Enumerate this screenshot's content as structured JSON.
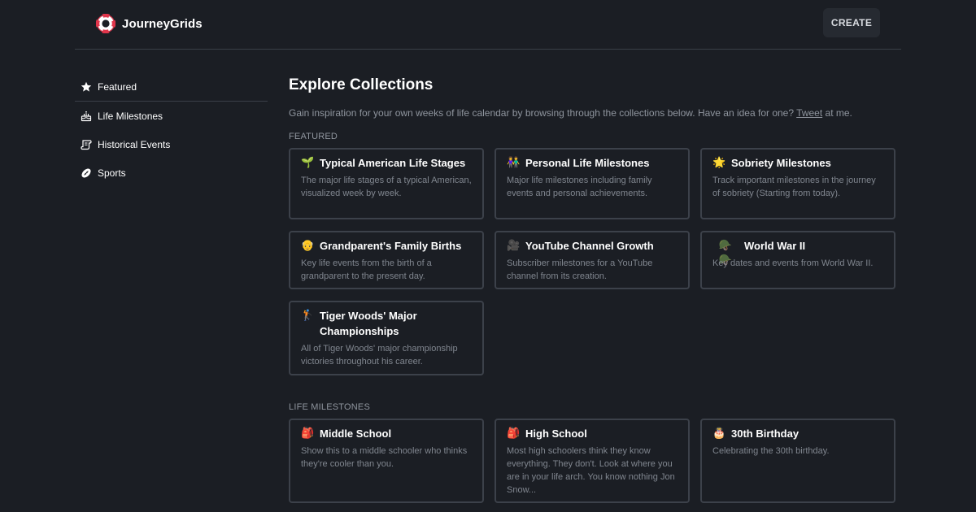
{
  "header": {
    "brand_name": "JourneyGrids",
    "create_label": "CREATE"
  },
  "sidebar": {
    "items": [
      {
        "label": "Featured",
        "icon": "star-icon",
        "active": true
      },
      {
        "label": "Life Milestones",
        "icon": "cake-icon"
      },
      {
        "label": "Historical Events",
        "icon": "scroll-icon"
      },
      {
        "label": "Sports",
        "icon": "football-icon"
      }
    ]
  },
  "main": {
    "title": "Explore Collections",
    "intro_before": "Gain inspiration for your own weeks of life calendar by browsing through the collections below. Have an idea for one?",
    "intro_link": "Tweet",
    "intro_after": "at me.",
    "sections": [
      {
        "label": "FEATURED",
        "cards": [
          {
            "emoji": "🌱",
            "title": "Typical American Life Stages",
            "description": "The major life stages of a typical American, visualized week by week."
          },
          {
            "emoji": "👫",
            "title": "Personal Life Milestones",
            "description": "Major life milestones including family events and personal achievements."
          },
          {
            "emoji": "🌟",
            "title": "Sobriety Milestones",
            "description": "Track important milestones in the journey of sobriety (Starting from today)."
          },
          {
            "emoji": "👴",
            "title": "Grandparent's Family Births",
            "description": "Key life events from the birth of a grandparent to the present day."
          },
          {
            "emoji": "🎥",
            "title": "YouTube Channel Growth",
            "description": "Subscriber milestones for a YouTube channel from its creation."
          },
          {
            "emoji": "🪖🪖",
            "title": "World War II",
            "description": "Key dates and events from World War II."
          },
          {
            "emoji": "🏌",
            "title": "Tiger Woods' Major Championships",
            "description": "All of Tiger Woods' major championship victories throughout his career."
          }
        ]
      },
      {
        "label": "LIFE MILESTONES",
        "cards": [
          {
            "emoji": "🎒",
            "title": "Middle School",
            "description": "Show this to a middle schooler who thinks they're cooler than you."
          },
          {
            "emoji": "🎒",
            "title": "High School",
            "description": "Most high schoolers think they know everything. They don't. Look at where you are in your life arch. You know nothing Jon Snow..."
          },
          {
            "emoji": "🎂",
            "title": "30th Birthday",
            "description": "Celebrating the 30th birthday."
          }
        ]
      }
    ]
  },
  "colors": {
    "background": "#1b1e24",
    "card_border": "#3c414a",
    "muted_text": "#8f959e",
    "brand_red": "#e0354b"
  }
}
